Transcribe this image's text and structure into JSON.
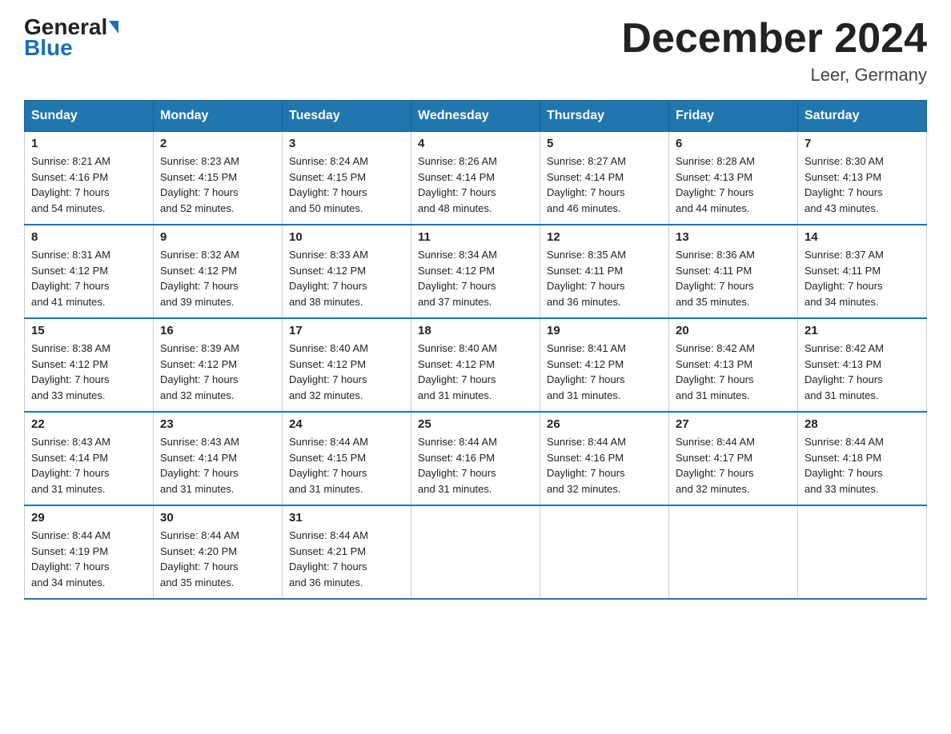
{
  "header": {
    "logo_general": "General",
    "logo_blue": "Blue",
    "month_title": "December 2024",
    "location": "Leer, Germany"
  },
  "days_of_week": [
    "Sunday",
    "Monday",
    "Tuesday",
    "Wednesday",
    "Thursday",
    "Friday",
    "Saturday"
  ],
  "weeks": [
    [
      {
        "day": "1",
        "sunrise": "8:21 AM",
        "sunset": "4:16 PM",
        "daylight": "7 hours and 54 minutes."
      },
      {
        "day": "2",
        "sunrise": "8:23 AM",
        "sunset": "4:15 PM",
        "daylight": "7 hours and 52 minutes."
      },
      {
        "day": "3",
        "sunrise": "8:24 AM",
        "sunset": "4:15 PM",
        "daylight": "7 hours and 50 minutes."
      },
      {
        "day": "4",
        "sunrise": "8:26 AM",
        "sunset": "4:14 PM",
        "daylight": "7 hours and 48 minutes."
      },
      {
        "day": "5",
        "sunrise": "8:27 AM",
        "sunset": "4:14 PM",
        "daylight": "7 hours and 46 minutes."
      },
      {
        "day": "6",
        "sunrise": "8:28 AM",
        "sunset": "4:13 PM",
        "daylight": "7 hours and 44 minutes."
      },
      {
        "day": "7",
        "sunrise": "8:30 AM",
        "sunset": "4:13 PM",
        "daylight": "7 hours and 43 minutes."
      }
    ],
    [
      {
        "day": "8",
        "sunrise": "8:31 AM",
        "sunset": "4:12 PM",
        "daylight": "7 hours and 41 minutes."
      },
      {
        "day": "9",
        "sunrise": "8:32 AM",
        "sunset": "4:12 PM",
        "daylight": "7 hours and 39 minutes."
      },
      {
        "day": "10",
        "sunrise": "8:33 AM",
        "sunset": "4:12 PM",
        "daylight": "7 hours and 38 minutes."
      },
      {
        "day": "11",
        "sunrise": "8:34 AM",
        "sunset": "4:12 PM",
        "daylight": "7 hours and 37 minutes."
      },
      {
        "day": "12",
        "sunrise": "8:35 AM",
        "sunset": "4:11 PM",
        "daylight": "7 hours and 36 minutes."
      },
      {
        "day": "13",
        "sunrise": "8:36 AM",
        "sunset": "4:11 PM",
        "daylight": "7 hours and 35 minutes."
      },
      {
        "day": "14",
        "sunrise": "8:37 AM",
        "sunset": "4:11 PM",
        "daylight": "7 hours and 34 minutes."
      }
    ],
    [
      {
        "day": "15",
        "sunrise": "8:38 AM",
        "sunset": "4:12 PM",
        "daylight": "7 hours and 33 minutes."
      },
      {
        "day": "16",
        "sunrise": "8:39 AM",
        "sunset": "4:12 PM",
        "daylight": "7 hours and 32 minutes."
      },
      {
        "day": "17",
        "sunrise": "8:40 AM",
        "sunset": "4:12 PM",
        "daylight": "7 hours and 32 minutes."
      },
      {
        "day": "18",
        "sunrise": "8:40 AM",
        "sunset": "4:12 PM",
        "daylight": "7 hours and 31 minutes."
      },
      {
        "day": "19",
        "sunrise": "8:41 AM",
        "sunset": "4:12 PM",
        "daylight": "7 hours and 31 minutes."
      },
      {
        "day": "20",
        "sunrise": "8:42 AM",
        "sunset": "4:13 PM",
        "daylight": "7 hours and 31 minutes."
      },
      {
        "day": "21",
        "sunrise": "8:42 AM",
        "sunset": "4:13 PM",
        "daylight": "7 hours and 31 minutes."
      }
    ],
    [
      {
        "day": "22",
        "sunrise": "8:43 AM",
        "sunset": "4:14 PM",
        "daylight": "7 hours and 31 minutes."
      },
      {
        "day": "23",
        "sunrise": "8:43 AM",
        "sunset": "4:14 PM",
        "daylight": "7 hours and 31 minutes."
      },
      {
        "day": "24",
        "sunrise": "8:44 AM",
        "sunset": "4:15 PM",
        "daylight": "7 hours and 31 minutes."
      },
      {
        "day": "25",
        "sunrise": "8:44 AM",
        "sunset": "4:16 PM",
        "daylight": "7 hours and 31 minutes."
      },
      {
        "day": "26",
        "sunrise": "8:44 AM",
        "sunset": "4:16 PM",
        "daylight": "7 hours and 32 minutes."
      },
      {
        "day": "27",
        "sunrise": "8:44 AM",
        "sunset": "4:17 PM",
        "daylight": "7 hours and 32 minutes."
      },
      {
        "day": "28",
        "sunrise": "8:44 AM",
        "sunset": "4:18 PM",
        "daylight": "7 hours and 33 minutes."
      }
    ],
    [
      {
        "day": "29",
        "sunrise": "8:44 AM",
        "sunset": "4:19 PM",
        "daylight": "7 hours and 34 minutes."
      },
      {
        "day": "30",
        "sunrise": "8:44 AM",
        "sunset": "4:20 PM",
        "daylight": "7 hours and 35 minutes."
      },
      {
        "day": "31",
        "sunrise": "8:44 AM",
        "sunset": "4:21 PM",
        "daylight": "7 hours and 36 minutes."
      },
      null,
      null,
      null,
      null
    ]
  ],
  "labels": {
    "sunrise": "Sunrise:",
    "sunset": "Sunset:",
    "daylight": "Daylight:"
  }
}
